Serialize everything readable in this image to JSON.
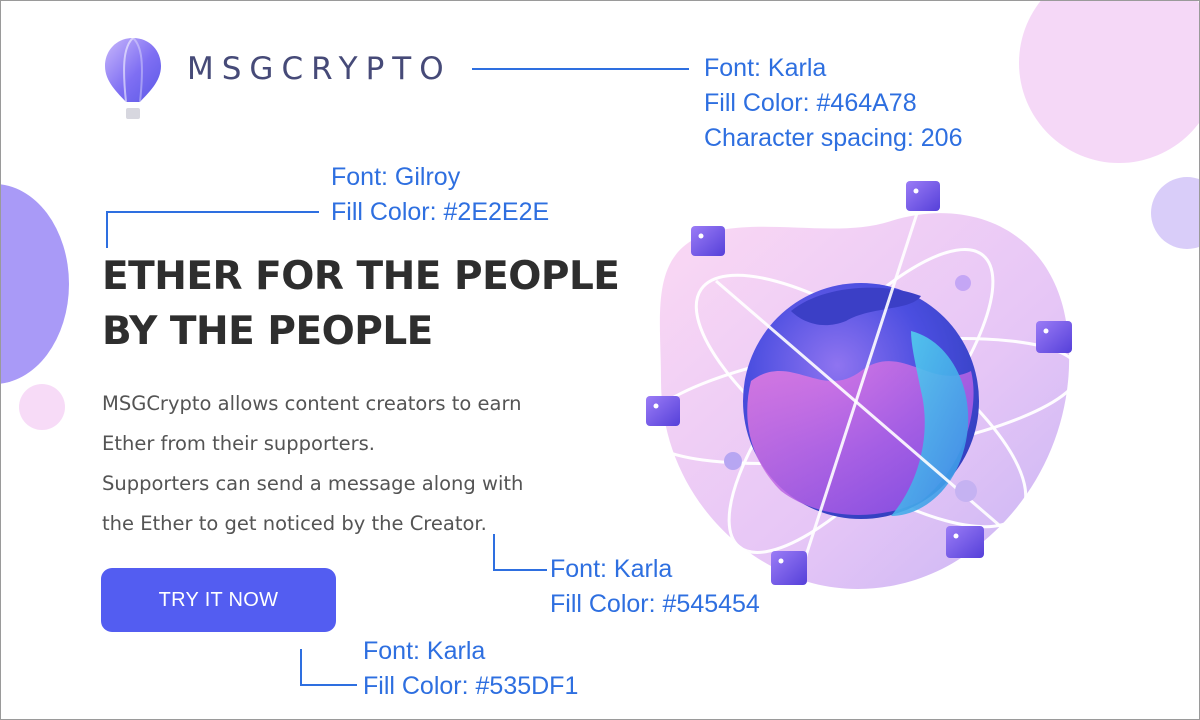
{
  "brand": {
    "name": "MSGCRYPTO"
  },
  "hero": {
    "headline_lines": [
      "ETHER FOR THE PEOPLE",
      "BY THE PEOPLE"
    ],
    "body_lines": [
      "MSGCrypto allows content creators to earn",
      "Ether from their supporters.",
      "Supporters can send a message along with",
      "the Ether to get noticed by the Creator."
    ],
    "cta_label": "TRY IT NOW"
  },
  "annotations": {
    "logo": [
      "Font: Karla",
      "Fill Color: #464A78",
      "Character spacing: 206"
    ],
    "headline": [
      "Font: Gilroy",
      "Fill Color: #2E2E2E"
    ],
    "body": [
      "Font: Karla",
      "Fill Color: #545454"
    ],
    "button": [
      "Font: Karla",
      "Fill Color: #535DF1"
    ]
  },
  "colors": {
    "brand_text": "#464A78",
    "headline_text": "#2E2E2E",
    "body_text": "#545454",
    "button_fill": "#535DF1",
    "annotation_text": "#2E6FE0"
  },
  "icons": {
    "logo": "hot-air-balloon-icon",
    "illustration": "globe-with-orbiting-cubes"
  }
}
